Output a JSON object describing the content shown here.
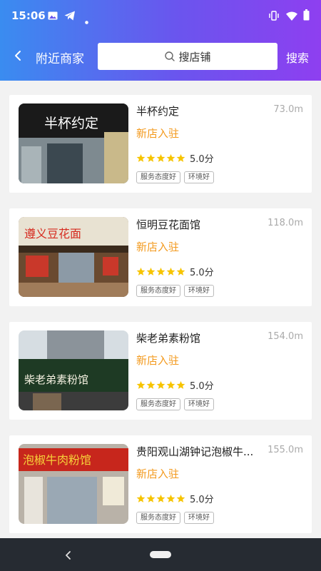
{
  "status": {
    "time": "15:06"
  },
  "nav": {
    "title": "附近商家",
    "search_placeholder": "搜店铺",
    "search_button": "搜索"
  },
  "shops": [
    {
      "name": "半杯约定",
      "distance": "73.0m",
      "badge": "新店入驻",
      "score": "5.0分",
      "stars": 5,
      "tags": [
        "服务态度好",
        "环境好"
      ],
      "sign_text": "半杯约定"
    },
    {
      "name": "恒明豆花面馆",
      "distance": "118.0m",
      "badge": "新店入驻",
      "score": "5.0分",
      "stars": 5,
      "tags": [
        "服务态度好",
        "环境好"
      ],
      "sign_text": "遵义豆花面"
    },
    {
      "name": "柴老弟素粉馆",
      "distance": "154.0m",
      "badge": "新店入驻",
      "score": "5.0分",
      "stars": 5,
      "tags": [
        "服务态度好",
        "环境好"
      ],
      "sign_text": "柴老弟素粉馆"
    },
    {
      "name": "贵阳观山湖钟记泡椒牛...",
      "distance": "155.0m",
      "badge": "新店入驻",
      "score": "5.0分",
      "stars": 5,
      "tags": [
        "服务态度好",
        "环境好"
      ],
      "sign_text": "泡椒牛肉粉馆"
    }
  ],
  "colors": {
    "header_start": "#3a8cf0",
    "header_end": "#8e3ff0",
    "badge": "#f39a1e",
    "star": "#f7c400"
  }
}
